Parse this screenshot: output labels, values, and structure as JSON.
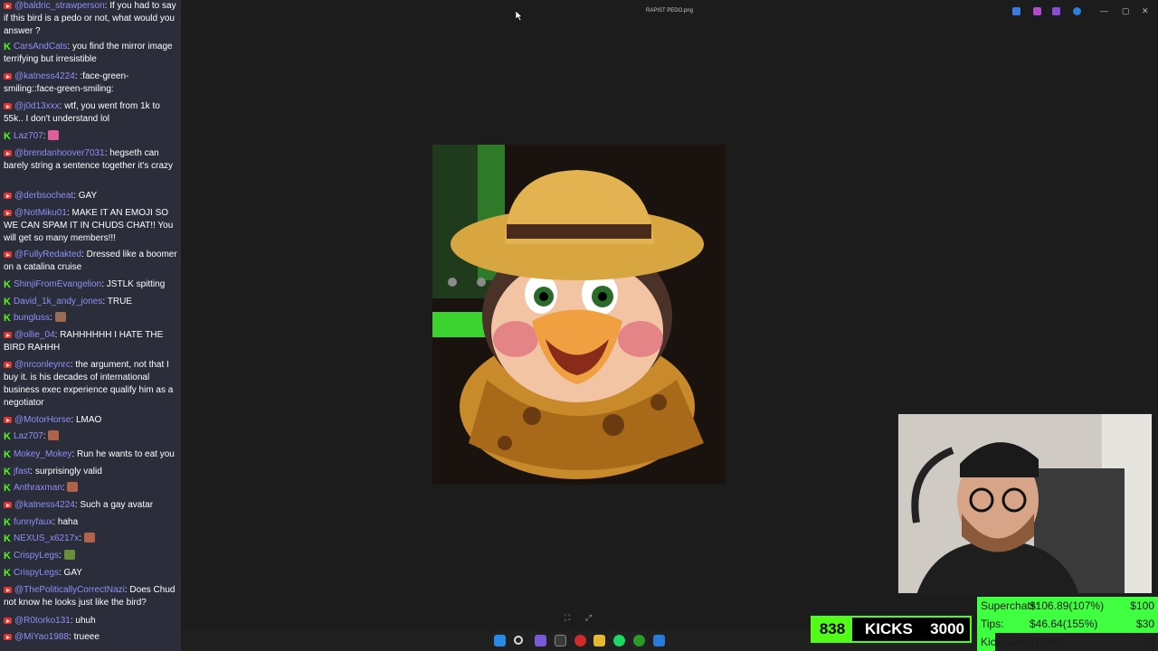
{
  "chat": [
    {
      "platform": "yt",
      "user": "@baldric_strawperson",
      "text": "If you had to say if this bird is a pedo or not, what would you answer ?"
    },
    {
      "platform": "kick",
      "user": "CarsAndCats",
      "text": "you find the mirror image terrifying but irresistible"
    },
    {
      "platform": "yt",
      "user": "@katness4224",
      "text": ":face-green-smiling::face-green-smiling:"
    },
    {
      "platform": "yt",
      "user": "@j0d13xxx",
      "text": "wtf, you went from 1k to 55k.. I don't understand lol"
    },
    {
      "platform": "kick",
      "user": "Laz707",
      "text": "",
      "emote": "#e05c9b"
    },
    {
      "platform": "yt",
      "user": "@brendanhoover7031",
      "text": "hegseth can barely string a sentence together it's crazy"
    },
    {
      "platform": "yt",
      "user": "@derbsocheat",
      "text": "GAY"
    },
    {
      "platform": "yt",
      "user": "@NotMiku01",
      "text": "MAKE IT AN EMOJI SO WE CAN SPAM IT IN CHUDS CHAT!! You will get so many members!!!"
    },
    {
      "platform": "yt",
      "user": "@FullyRedakted",
      "text": "Dressed like a boomer on a catalina cruise"
    },
    {
      "platform": "kick",
      "user": "ShinjiFromEvangelion",
      "text": "JSTLK spitting"
    },
    {
      "platform": "kick",
      "user": "David_1k_andy_jones",
      "text": "TRUE"
    },
    {
      "platform": "kick",
      "user": "bungluss",
      "text": "",
      "emote": "#9a6b55"
    },
    {
      "platform": "yt",
      "user": "@ollie_04",
      "text": "RAHHHHHH I HATE THE BIRD RAHHH"
    },
    {
      "platform": "yt",
      "user": "@nrconleynrc",
      "text": "the argument, not that I buy it. is his decades of international business exec experience qualify him as a negotiator"
    },
    {
      "platform": "yt",
      "user": "@MotorHorse",
      "text": "LMAO"
    },
    {
      "platform": "kick",
      "user": "Laz707",
      "text": "",
      "emote": "#b0624a"
    },
    {
      "platform": "kick",
      "user": "Mokey_Mokey",
      "text": "Run he wants to eat you"
    },
    {
      "platform": "kick",
      "user": "jfast",
      "text": "surprisingly valid"
    },
    {
      "platform": "kick",
      "user": "Anthraxman",
      "text": "",
      "emote": "#b0624a"
    },
    {
      "platform": "yt",
      "user": "@katness4224",
      "text": "Such a gay avatar"
    },
    {
      "platform": "kick",
      "user": "funnyfaux",
      "text": "haha"
    },
    {
      "platform": "kick",
      "user": "NEXUS_x6217x",
      "text": "",
      "emote": "#b0624a"
    },
    {
      "platform": "kick",
      "user": "CrispyLegs",
      "text": "",
      "emote": "#6a8f3a"
    },
    {
      "platform": "kick",
      "user": "CrispyLegs",
      "text": "GAY"
    },
    {
      "platform": "yt",
      "user": "@ThePoliticallyCorrectNazi",
      "text": "Does Chud not know he looks just like the bird?"
    },
    {
      "platform": "yt",
      "user": "@R0torko131",
      "text": "uhuh"
    },
    {
      "platform": "yt",
      "user": "@MiYao1988",
      "text": "trueee"
    }
  ],
  "viewer": {
    "file_title": "RAPIST PEDO.png"
  },
  "stats": {
    "kicks_count": "838",
    "kicks_label": "KICKS",
    "kicks_goal": "3000",
    "goals": [
      {
        "label": "Superchats:",
        "value": "$106.89(107%)",
        "target": "$100",
        "progress": 1.0
      },
      {
        "label": "Tips:",
        "value": "$46.64(155%)",
        "target": "$30",
        "progress": 1.0
      },
      {
        "label": "Kick Subs:",
        "value": "1(10%)",
        "target": "10",
        "progress": 0.1
      }
    ]
  },
  "colors": {
    "kick_green": "#53fc18",
    "yt_red": "#e8322c",
    "username": "#8f8ff7",
    "chat_bg": "#2b2e3a"
  }
}
